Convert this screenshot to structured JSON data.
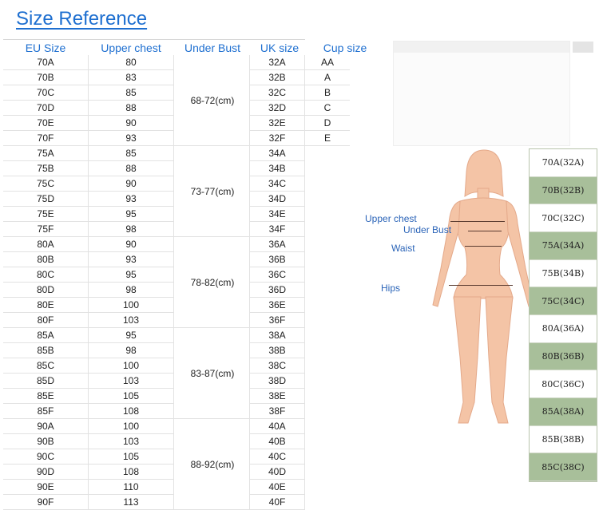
{
  "title": "Size Reference",
  "table": {
    "headers": [
      "EU Size",
      "Upper chest",
      "Under Bust",
      "UK size",
      "Cup size"
    ],
    "eu_sizes": [
      "70A",
      "70B",
      "70C",
      "70D",
      "70E",
      "70F",
      "75A",
      "75B",
      "75C",
      "75D",
      "75E",
      "75F",
      "80A",
      "80B",
      "80C",
      "80D",
      "80E",
      "80F",
      "85A",
      "85B",
      "85C",
      "85D",
      "85E",
      "85F",
      "90A",
      "90B",
      "90C",
      "90D",
      "90E",
      "90F"
    ],
    "upper_chest": [
      "80",
      "83",
      "85",
      "88",
      "90",
      "93",
      "85",
      "88",
      "90",
      "93",
      "95",
      "98",
      "90",
      "93",
      "95",
      "98",
      "100",
      "103",
      "95",
      "98",
      "100",
      "103",
      "105",
      "108",
      "100",
      "103",
      "105",
      "108",
      "110",
      "113"
    ],
    "under_bust": [
      "68-72(cm)",
      "73-77(cm)",
      "78-82(cm)",
      "83-87(cm)",
      "88-92(cm)"
    ],
    "uk_sizes": [
      "32A",
      "32B",
      "32C",
      "32D",
      "32E",
      "32F",
      "34A",
      "34B",
      "34C",
      "34D",
      "34E",
      "34F",
      "36A",
      "36B",
      "36C",
      "36D",
      "36E",
      "36F",
      "38A",
      "38B",
      "38C",
      "38D",
      "38E",
      "38F",
      "40A",
      "40B",
      "40C",
      "40D",
      "40E",
      "40F"
    ],
    "cup_sizes": [
      "AA",
      "A",
      "B",
      "C",
      "D",
      "E"
    ]
  },
  "figure": {
    "labels": {
      "upper_chest": "Upper chest",
      "under_bust": "Under Bust",
      "waist": "Waist",
      "hips": "Hips"
    },
    "skin_color": "#f4c4a6",
    "line_color": "#5a3b30"
  },
  "size_strip": [
    {
      "label": "70A(32A)",
      "green": false
    },
    {
      "label": "70B(32B)",
      "green": true
    },
    {
      "label": "70C(32C)",
      "green": false
    },
    {
      "label": "75A(34A)",
      "green": true
    },
    {
      "label": "75B(34B)",
      "green": false
    },
    {
      "label": "75C(34C)",
      "green": true
    },
    {
      "label": "80A(36A)",
      "green": false
    },
    {
      "label": "80B(36B)",
      "green": true
    },
    {
      "label": "80C(36C)",
      "green": false
    },
    {
      "label": "85A(38A)",
      "green": true
    },
    {
      "label": "85B(38B)",
      "green": false
    },
    {
      "label": "85C(38C)",
      "green": true
    }
  ]
}
